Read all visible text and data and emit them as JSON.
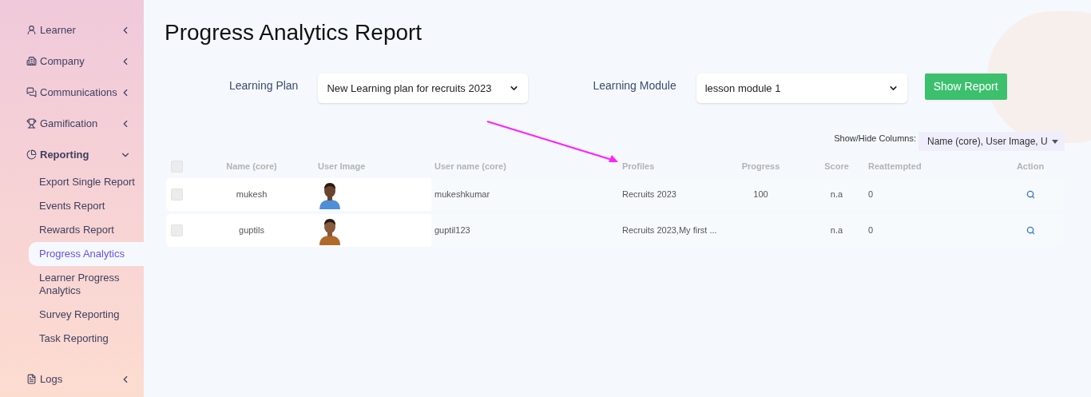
{
  "sidebar": {
    "items": [
      {
        "label": "Learner",
        "expanded": false
      },
      {
        "label": "Company",
        "expanded": false
      },
      {
        "label": "Communications",
        "expanded": false
      },
      {
        "label": "Gamification",
        "expanded": false
      },
      {
        "label": "Reporting",
        "expanded": true,
        "children": [
          {
            "label": "Export Single Report",
            "selected": false
          },
          {
            "label": "Events Report",
            "selected": false
          },
          {
            "label": "Rewards Report",
            "selected": false
          },
          {
            "label": "Progress Analytics",
            "selected": true
          },
          {
            "label": "Learner Progress Analytics",
            "selected": false
          },
          {
            "label": "Survey Reporting",
            "selected": false
          },
          {
            "label": "Task Reporting",
            "selected": false
          }
        ]
      },
      {
        "label": "Logs",
        "expanded": false
      }
    ]
  },
  "title": "Progress Analytics Report",
  "filters": [
    {
      "label": "Learning Plan",
      "value": "New Learning plan for recruits 2023"
    },
    {
      "label": "Learning Module",
      "value": "lesson module 1"
    }
  ],
  "show_report_button": "Show Report",
  "columns_toggle": {
    "label": "Show/Hide Columns:",
    "value": "Name (core), User Image, U"
  },
  "table": {
    "select_all_checked": false,
    "columns": [
      "Name (core)",
      "User Image",
      "User name (core)",
      "Profiles",
      "Progress",
      "Score",
      "Reattempted",
      "Action"
    ],
    "rows": [
      {
        "checked": false,
        "name": "mukesh",
        "username": "mukeshkumar",
        "profiles": "Recruits 2023",
        "progress": "100",
        "score": "n.a",
        "reattempted": "0"
      },
      {
        "checked": false,
        "name": "guptils",
        "username": "guptil123",
        "profiles": "Recruits 2023,My first ...",
        "score": "n.a",
        "reattempted": "0"
      }
    ]
  }
}
